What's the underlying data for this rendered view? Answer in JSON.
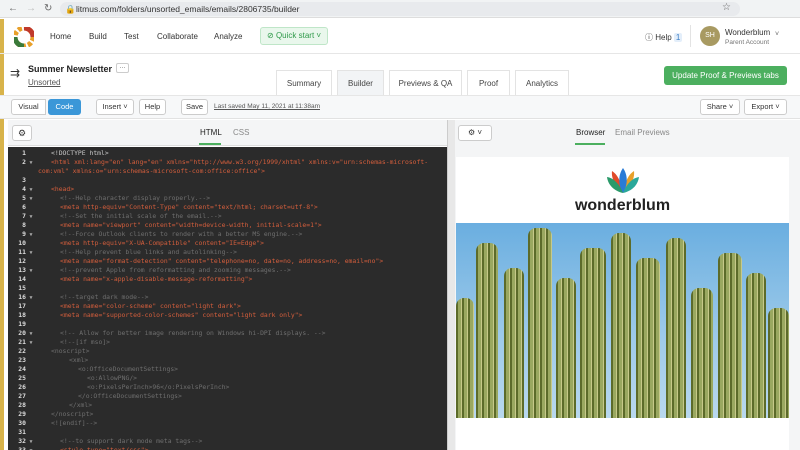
{
  "browser": {
    "url": "litmus.com/folders/unsorted_emails/emails/2806735/builder"
  },
  "nav": {
    "items": [
      "Home",
      "Build",
      "Test",
      "Collaborate",
      "Analyze"
    ],
    "quick_start": "Quick start",
    "help": "Help",
    "help_badge": "1",
    "avatar_initials": "SH",
    "account_name": "Wonderblum",
    "account_role": "Parent Account"
  },
  "email": {
    "title": "Summer Newsletter",
    "folder": "Unsorted",
    "more": "···"
  },
  "tabs": [
    {
      "label": "Summary"
    },
    {
      "label": "Builder",
      "active": true
    },
    {
      "label": "Previews & QA"
    },
    {
      "label": "Proof"
    },
    {
      "label": "Analytics"
    }
  ],
  "update_button": "Update Proof & Previews tabs",
  "toolbar": {
    "visual": "Visual",
    "code": "Code",
    "insert": "Insert",
    "help": "Help",
    "save": "Save",
    "last_saved": "Last saved May 11, 2021 at 11:38am",
    "share": "Share",
    "export": "Export"
  },
  "editor": {
    "tabs": [
      "HTML",
      "CSS"
    ],
    "active_tab": "HTML"
  },
  "code_lines": [
    {
      "n": "1",
      "f": false,
      "i": 1,
      "k": "text",
      "t": "<!DOCTYPE html>"
    },
    {
      "n": "2",
      "f": true,
      "i": 1,
      "k": "tag",
      "t": "<html xml:lang=\"en\" lang=\"en\" xmlns=\"http://www.w3.org/1999/xhtml\" xmlns:v=\"urn:schemas-microsoft-"
    },
    {
      "n": "",
      "f": false,
      "i": 0,
      "k": "tag",
      "t": "com:vml\" xmlns:o=\"urn:schemas-microsoft-com:office:office\">"
    },
    {
      "n": "3",
      "f": false,
      "i": 0,
      "k": "text",
      "t": ""
    },
    {
      "n": "4",
      "f": true,
      "i": 1,
      "k": "tag",
      "t": "<head>"
    },
    {
      "n": "5",
      "f": true,
      "i": 2,
      "k": "comment",
      "t": "<!--Help character display properly.-->"
    },
    {
      "n": "6",
      "f": false,
      "i": 2,
      "k": "tag",
      "t": "<meta http-equiv=\"Content-Type\" content=\"text/html; charset=utf-8\">"
    },
    {
      "n": "7",
      "f": true,
      "i": 2,
      "k": "comment",
      "t": "<!--Set the initial scale of the email.-->"
    },
    {
      "n": "8",
      "f": false,
      "i": 2,
      "k": "tag",
      "t": "<meta name=\"viewport\" content=\"width=device-width, initial-scale=1\">"
    },
    {
      "n": "9",
      "f": true,
      "i": 2,
      "k": "comment",
      "t": "<!--Force Outlook clients to render with a better MS engine.-->"
    },
    {
      "n": "10",
      "f": false,
      "i": 2,
      "k": "tag",
      "t": "<meta http-equiv=\"X-UA-Compatible\" content=\"IE=Edge\">"
    },
    {
      "n": "11",
      "f": true,
      "i": 2,
      "k": "comment",
      "t": "<!--Help prevent blue links and autolinking-->"
    },
    {
      "n": "12",
      "f": false,
      "i": 2,
      "k": "tag",
      "t": "<meta name=\"format-detection\" content=\"telephone=no, date=no, address=no, email=no\">"
    },
    {
      "n": "13",
      "f": true,
      "i": 2,
      "k": "comment",
      "t": "<!--prevent Apple from reformatting and zooming messages.-->"
    },
    {
      "n": "14",
      "f": false,
      "i": 2,
      "k": "tag",
      "t": "<meta name=\"x-apple-disable-message-reformatting\">"
    },
    {
      "n": "15",
      "f": false,
      "i": 0,
      "k": "text",
      "t": ""
    },
    {
      "n": "16",
      "f": true,
      "i": 2,
      "k": "comment",
      "t": "<!--target dark mode-->"
    },
    {
      "n": "17",
      "f": false,
      "i": 2,
      "k": "tag",
      "t": "<meta name=\"color-scheme\" content=\"light dark\">"
    },
    {
      "n": "18",
      "f": false,
      "i": 2,
      "k": "tag",
      "t": "<meta name=\"supported-color-schemes\" content=\"light dark only\">"
    },
    {
      "n": "19",
      "f": false,
      "i": 0,
      "k": "text",
      "t": ""
    },
    {
      "n": "20",
      "f": true,
      "i": 2,
      "k": "comment",
      "t": "<!-- Allow for better image rendering on Windows hi-DPI displays. -->"
    },
    {
      "n": "21",
      "f": true,
      "i": 2,
      "k": "comment",
      "t": "<!--[if mso]>"
    },
    {
      "n": "22",
      "f": false,
      "i": 1,
      "k": "comment",
      "t": "<noscript>"
    },
    {
      "n": "23",
      "f": false,
      "i": 3,
      "k": "comment",
      "t": "<xml>"
    },
    {
      "n": "24",
      "f": false,
      "i": 4,
      "k": "comment",
      "t": "<o:OfficeDocumentSettings>"
    },
    {
      "n": "25",
      "f": false,
      "i": 5,
      "k": "comment",
      "t": "<o:AllowPNG/>"
    },
    {
      "n": "26",
      "f": false,
      "i": 5,
      "k": "comment",
      "t": "<o:PixelsPerInch>96</o:PixelsPerInch>"
    },
    {
      "n": "27",
      "f": false,
      "i": 4,
      "k": "comment",
      "t": "</o:OfficeDocumentSettings>"
    },
    {
      "n": "28",
      "f": false,
      "i": 3,
      "k": "comment",
      "t": "</xml>"
    },
    {
      "n": "29",
      "f": false,
      "i": 1,
      "k": "comment",
      "t": "</noscript>"
    },
    {
      "n": "30",
      "f": false,
      "i": 1,
      "k": "comment",
      "t": "<![endif]-->"
    },
    {
      "n": "31",
      "f": false,
      "i": 0,
      "k": "text",
      "t": ""
    },
    {
      "n": "32",
      "f": true,
      "i": 2,
      "k": "comment",
      "t": "<!--to support dark mode meta tags-->"
    },
    {
      "n": "33",
      "f": true,
      "i": 2,
      "k": "tag",
      "t": "<style type=\"text/css\">"
    }
  ],
  "preview": {
    "tabs": [
      "Browser",
      "Email Previews"
    ],
    "active_tab": "Browser",
    "brand": "wonderblum"
  },
  "colors": {
    "accent": "#3b97d8",
    "green": "#4caf5f"
  }
}
